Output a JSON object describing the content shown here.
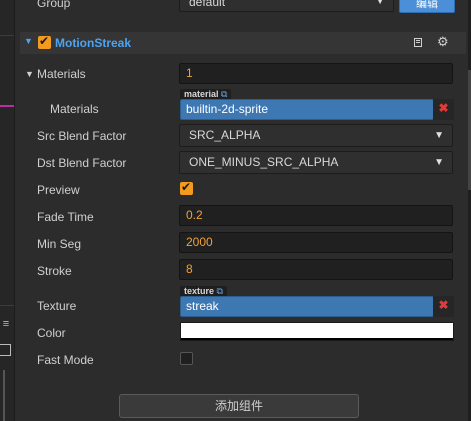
{
  "group": {
    "label": "Group",
    "value": "default",
    "button_label": "编辑"
  },
  "component": {
    "name": "MotionStreak",
    "enabled": true,
    "doc_icon": "book-icon",
    "settings_icon": "gear-icon"
  },
  "materials": {
    "label": "Materials",
    "count": "1",
    "item_label": "Materials",
    "tag": "material",
    "value": "builtin-2d-sprite"
  },
  "src_blend": {
    "label": "Src Blend Factor",
    "value": "SRC_ALPHA"
  },
  "dst_blend": {
    "label": "Dst Blend Factor",
    "value": "ONE_MINUS_SRC_ALPHA"
  },
  "preview": {
    "label": "Preview",
    "checked": true
  },
  "fade_time": {
    "label": "Fade Time",
    "value": "0.2"
  },
  "min_seg": {
    "label": "Min Seg",
    "value": "2000"
  },
  "stroke": {
    "label": "Stroke",
    "value": "8"
  },
  "texture": {
    "label": "Texture",
    "tag": "texture",
    "value": "streak"
  },
  "color": {
    "label": "Color",
    "value": "#ffffff"
  },
  "fast_mode": {
    "label": "Fast Mode",
    "checked": false
  },
  "add_component": {
    "label": "添加组件"
  },
  "colors": {
    "accent_orange": "#f39a21",
    "asset_blue": "#3d78b3",
    "title_blue": "#4ea3f0",
    "remove_red": "#e03b3b"
  }
}
